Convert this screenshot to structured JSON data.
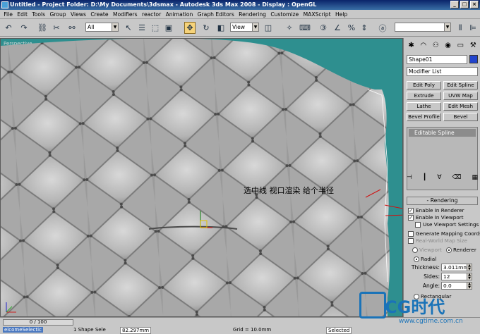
{
  "window": {
    "title": "Untitled    - Project Folder: D:\\My Documents\\3dsmax    - Autodesk 3ds Max 2008    - Display : OpenGL"
  },
  "menu": [
    "File",
    "Edit",
    "Tools",
    "Group",
    "Views",
    "Create",
    "Modifiers",
    "reactor",
    "Animation",
    "Graph Editors",
    "Rendering",
    "Customize",
    "MAXScript",
    "Help"
  ],
  "toolbar": {
    "selection_filter": "All",
    "reference_coord": "View"
  },
  "viewport": {
    "label": "Perspective",
    "annotation": "选中线  视口渲染      给个半径"
  },
  "command_panel": {
    "object_name": "Shape01",
    "object_color": "#2244cc",
    "modifier_list_label": "Modifier List",
    "modifier_buttons": [
      [
        "Edit Poly",
        "Edit Spline"
      ],
      [
        "Extrude",
        "UVW Map"
      ],
      [
        "Lathe",
        "Edit Mesh"
      ],
      [
        "Bevel Profile",
        "Bevel"
      ]
    ],
    "stack_item": "Editable Spline",
    "rendering_rollout": {
      "title": "Rendering",
      "enable_in_renderer": "Enable In Renderer",
      "enable_in_viewport": "Enable In Viewport",
      "use_viewport_settings": "Use Viewport Settings",
      "generate_mapping": "Generate Mapping Coords.",
      "real_world_map": "Real-World Map Size",
      "viewport_radio": "Viewport",
      "renderer_radio": "Renderer",
      "radial_radio": "Radial",
      "thickness_label": "Thickness:",
      "thickness_value": "3.011mm",
      "sides_label": "Sides:",
      "sides_value": "12",
      "angle_label": "Angle:",
      "angle_value": "0.0",
      "rectangular_radio": "Rectangular"
    }
  },
  "status": {
    "time": "0 / 100",
    "shape_count": "1 Shape Sele",
    "x_value": "82.297mm",
    "auto_key": "Selected",
    "grid": "Grid = 10.0mm",
    "bottom_left": "elcomeSelectic"
  },
  "watermark": {
    "brand": "CG时代",
    "url": "www.cgtime.com.cn"
  }
}
